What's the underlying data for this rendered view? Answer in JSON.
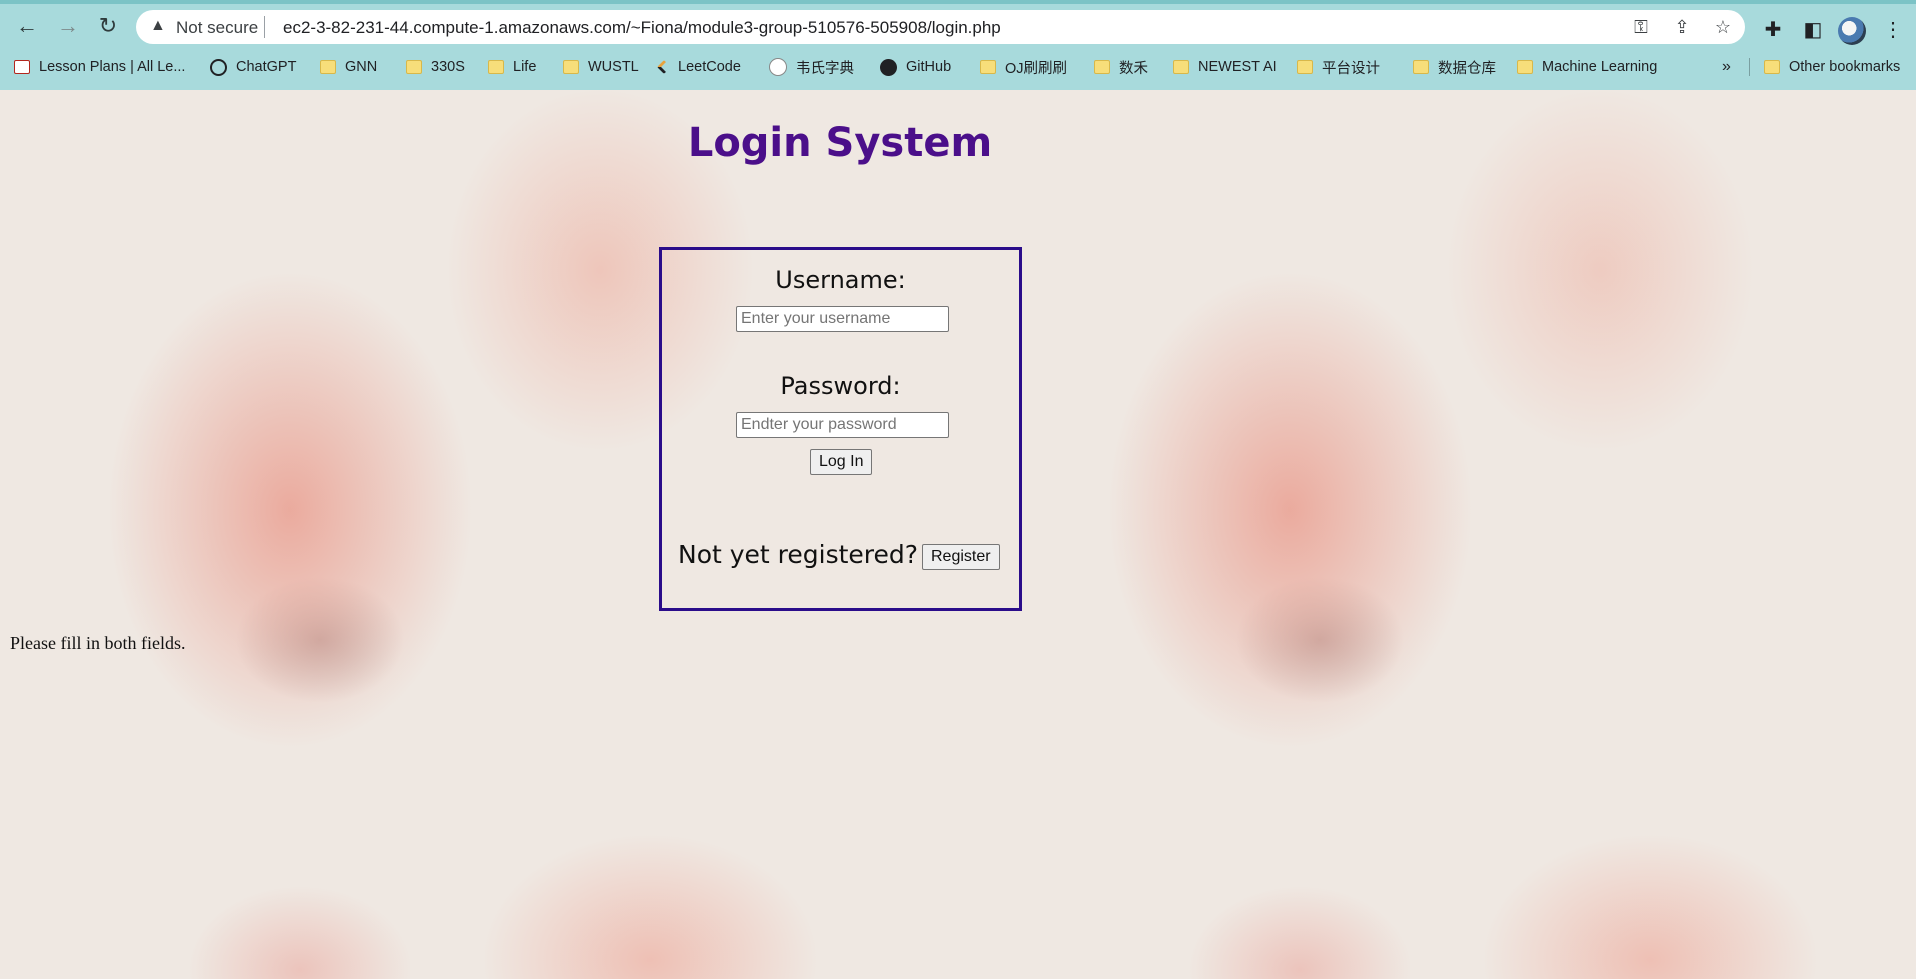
{
  "browser": {
    "security_label": "Not secure",
    "url": "ec2-3-82-231-44.compute-1.amazonaws.com/~Fiona/module3-group-510576-505908/login.php",
    "bookmarks": [
      {
        "label": "Lesson Plans | All Le...",
        "icon": "doc-icon"
      },
      {
        "label": "ChatGPT",
        "icon": "chatgpt-icon"
      },
      {
        "label": "GNN",
        "icon": "folder-icon"
      },
      {
        "label": "330S",
        "icon": "folder-icon"
      },
      {
        "label": "Life",
        "icon": "folder-icon"
      },
      {
        "label": "WUSTL",
        "icon": "folder-icon"
      },
      {
        "label": "LeetCode",
        "icon": "leetcode-icon"
      },
      {
        "label": "韦氏字典",
        "icon": "dictionary-icon"
      },
      {
        "label": "GitHub",
        "icon": "github-icon"
      },
      {
        "label": "OJ刷刷刷",
        "icon": "folder-icon"
      },
      {
        "label": "数禾",
        "icon": "folder-icon"
      },
      {
        "label": "NEWEST AI",
        "icon": "folder-icon"
      },
      {
        "label": "平台设计",
        "icon": "folder-icon"
      },
      {
        "label": "数据仓库",
        "icon": "folder-icon"
      },
      {
        "label": "Machine Learning",
        "icon": "folder-icon"
      }
    ],
    "overflow_label": "»",
    "other_bookmarks": "Other bookmarks"
  },
  "page": {
    "title": "Login System",
    "username_label": "Username:",
    "username_placeholder": "Enter your username",
    "password_label": "Password:",
    "password_placeholder": "Endter your password",
    "login_button": "Log In",
    "register_prompt": "Not yet registered?",
    "register_button": "Register",
    "message": "Please fill in both fields."
  },
  "colors": {
    "title": "#4b0f8a",
    "box_border": "#2a0c8a",
    "chrome_bg": "#a8dadc"
  }
}
